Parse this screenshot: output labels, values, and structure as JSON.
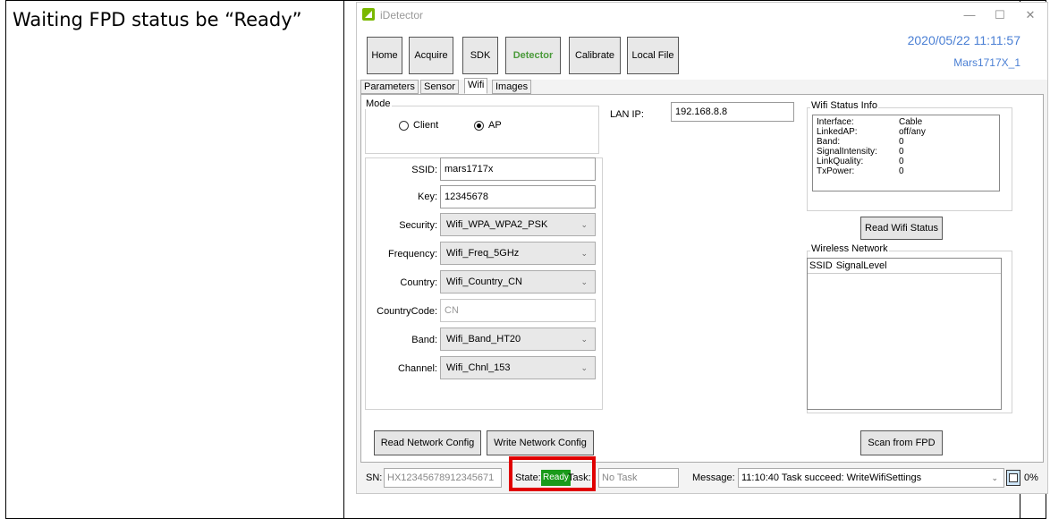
{
  "caption": "Waiting FPD status be “Ready”",
  "window": {
    "title": "iDetector",
    "minimize": "—",
    "maximize": "☐",
    "close": "✕"
  },
  "toolbar": {
    "buttons": [
      "Home",
      "Acquire",
      "SDK",
      "Detector",
      "Calibrate",
      "Local File"
    ],
    "active": "Detector",
    "datetime": "2020/05/22 11:11:57",
    "device": "Mars1717X_1"
  },
  "tabs": [
    "Parameters",
    "Sensor",
    "Wifi",
    "Images"
  ],
  "active_tab": "Wifi",
  "mode": {
    "label": "Mode",
    "options": [
      "Client",
      "AP"
    ],
    "selected": "AP"
  },
  "lan_ip": {
    "label": "LAN IP:",
    "value": "192.168.8.8"
  },
  "form": {
    "ssid": {
      "label": "SSID:",
      "value": "mars1717x"
    },
    "key": {
      "label": "Key:",
      "value": "12345678"
    },
    "security": {
      "label": "Security:",
      "value": "Wifi_WPA_WPA2_PSK"
    },
    "frequency": {
      "label": "Frequency:",
      "value": "Wifi_Freq_5GHz"
    },
    "country": {
      "label": "Country:",
      "value": "Wifi_Country_CN"
    },
    "country_code": {
      "label": "CountryCode:",
      "value": "CN"
    },
    "band": {
      "label": "Band:",
      "value": "Wifi_Band_HT20"
    },
    "channel": {
      "label": "Channel:",
      "value": "Wifi_Chnl_153"
    }
  },
  "wifi_status": {
    "label": "Wifi Status Info",
    "rows": [
      {
        "k": "Interface:",
        "v": "Cable"
      },
      {
        "k": "LinkedAP:",
        "v": "off/any"
      },
      {
        "k": "Band:",
        "v": "0"
      },
      {
        "k": "SignalIntensity:",
        "v": "0"
      },
      {
        "k": "LinkQuality:",
        "v": "0"
      },
      {
        "k": "TxPower:",
        "v": "0"
      }
    ],
    "read_button": "Read Wifi Status"
  },
  "wireless_network": {
    "label": "Wireless Network",
    "columns": [
      "SSID",
      "SignalLevel"
    ],
    "scan_button": "Scan from FPD"
  },
  "buttons": {
    "read_config": "Read Network Config",
    "write_config": "Write Network Config"
  },
  "status_bar": {
    "sn_label": "SN:",
    "sn_value": "HX12345678912345671",
    "state_label": "State:",
    "state_value": "Ready",
    "task_label": "Task:",
    "task_value": "No Task",
    "message_label": "Message:",
    "message_value": "11:10:40 Task succeed: WriteWifiSettings",
    "percent": "0%"
  },
  "colors": {
    "ready": "#1a9a1a",
    "accent": "#4a7fd4",
    "highlight": "#e00000"
  }
}
